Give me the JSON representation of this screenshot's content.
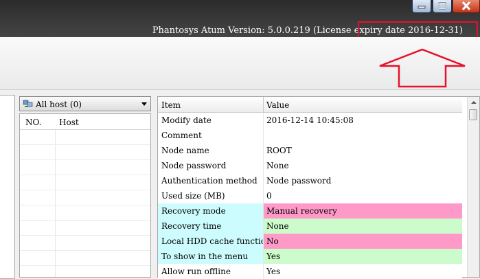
{
  "window": {
    "version_text": "Phantosys Atum Version: 5.0.0.219 (License expiry date 2016-12-31)",
    "colors": {
      "highlight": "#e8102a"
    }
  },
  "host_panel": {
    "dropdown_label": "All host (0)",
    "columns": [
      "NO.",
      "Host"
    ]
  },
  "properties": {
    "columns": [
      "Item",
      "Value"
    ],
    "rows": [
      {
        "item": "Modify date",
        "value": "2016-12-14 10:45:08",
        "item_bg": "#ffffff",
        "value_bg": "#ffffff"
      },
      {
        "item": "Comment",
        "value": "",
        "item_bg": "#ffffff",
        "value_bg": "#ffffff"
      },
      {
        "item": "Node name",
        "value": "ROOT",
        "item_bg": "#ffffff",
        "value_bg": "#ffffff"
      },
      {
        "item": "Node password",
        "value": "None",
        "item_bg": "#ffffff",
        "value_bg": "#ffffff"
      },
      {
        "item": "Authentication method",
        "value": "Node password",
        "item_bg": "#ffffff",
        "value_bg": "#ffffff"
      },
      {
        "item": "Used size (MB)",
        "value": "0",
        "item_bg": "#ffffff",
        "value_bg": "#ffffff"
      },
      {
        "item": "Recovery mode",
        "value": "Manual recovery",
        "item_bg": "#ccfcfe",
        "value_bg": "#ff99c8"
      },
      {
        "item": "Recovery time",
        "value": "None",
        "item_bg": "#ccfcfe",
        "value_bg": "#ccfccc"
      },
      {
        "item": "Local HDD cache function",
        "value": "No",
        "item_bg": "#ccfcfe",
        "value_bg": "#ff99c8"
      },
      {
        "item": "To show in the menu",
        "value": "Yes",
        "item_bg": "#ccfcfe",
        "value_bg": "#ccfccc"
      },
      {
        "item": "Allow run offline",
        "value": "Yes",
        "item_bg": "#ffffff",
        "value_bg": "#ffffff"
      }
    ]
  }
}
